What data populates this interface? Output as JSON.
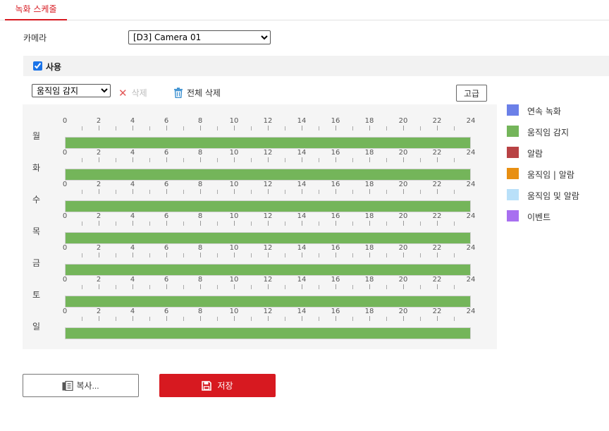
{
  "tabs": [
    {
      "label": "녹화 스케줄",
      "active": true
    }
  ],
  "camera": {
    "label": "카메라",
    "selected": "[D3] Camera 01"
  },
  "enable": {
    "label": "사용",
    "checked": true
  },
  "toolbar": {
    "type_selected": "움직임 감지",
    "delete_label": "삭제",
    "delete_all_label": "전체 삭제",
    "advanced_label": "고급"
  },
  "hour_labels": [
    "0",
    "2",
    "4",
    "6",
    "8",
    "10",
    "12",
    "14",
    "16",
    "18",
    "20",
    "22",
    "24"
  ],
  "days": [
    {
      "label": "월",
      "segments": [
        {
          "type": "motion",
          "start": 0,
          "end": 24
        }
      ]
    },
    {
      "label": "화",
      "segments": [
        {
          "type": "motion",
          "start": 0,
          "end": 24
        }
      ]
    },
    {
      "label": "수",
      "segments": [
        {
          "type": "motion",
          "start": 0,
          "end": 24
        }
      ]
    },
    {
      "label": "목",
      "segments": [
        {
          "type": "motion",
          "start": 0,
          "end": 24
        }
      ]
    },
    {
      "label": "금",
      "segments": [
        {
          "type": "motion",
          "start": 0,
          "end": 24
        }
      ]
    },
    {
      "label": "토",
      "segments": [
        {
          "type": "motion",
          "start": 0,
          "end": 24
        }
      ]
    },
    {
      "label": "일",
      "segments": [
        {
          "type": "motion",
          "start": 0,
          "end": 24
        }
      ]
    }
  ],
  "legend": [
    {
      "key": "continuous",
      "label": "연속 녹화",
      "color": "#6b80e8"
    },
    {
      "key": "motion",
      "label": "움직임 감지",
      "color": "#74b55a"
    },
    {
      "key": "alarm",
      "label": "알람",
      "color": "#b84244"
    },
    {
      "key": "motion_or_alarm",
      "label": "움직임 | 알람",
      "color": "#e88f12"
    },
    {
      "key": "motion_and_alarm",
      "label": "움직임 및 알람",
      "color": "#b9e0f9"
    },
    {
      "key": "event",
      "label": "이벤트",
      "color": "#a86ff0"
    }
  ],
  "buttons": {
    "copy_label": "복사...",
    "save_label": "저장"
  },
  "icons": {
    "delete": "close-x-icon",
    "delete_all": "trash-icon",
    "copy": "copy-icon",
    "save": "floppy-disk-icon"
  },
  "colors": {
    "accent": "#d71920",
    "save_button": "#d71920"
  }
}
